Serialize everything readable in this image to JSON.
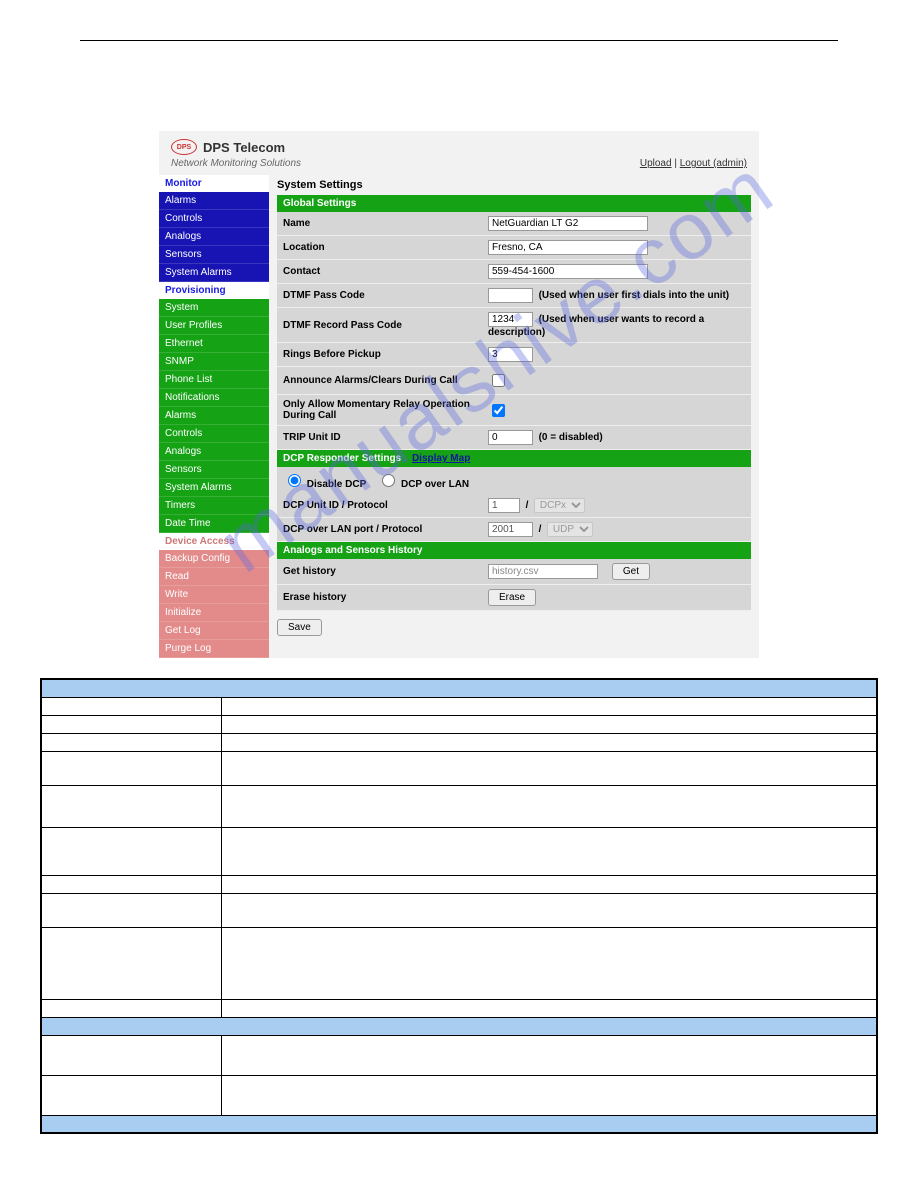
{
  "brand": {
    "name": "DPS Telecom",
    "tagline": "Network Monitoring Solutions",
    "logo_initials": "DPS"
  },
  "header_links": {
    "upload": "Upload",
    "logout": "Logout (admin)"
  },
  "sidebar": {
    "monitor": "Monitor",
    "monitor_items": [
      "Alarms",
      "Controls",
      "Analogs",
      "Sensors",
      "System Alarms"
    ],
    "provisioning": "Provisioning",
    "prov_items": [
      "System",
      "User Profiles",
      "Ethernet",
      "SNMP",
      "Phone List",
      "Notifications",
      "Alarms",
      "Controls",
      "Analogs",
      "Sensors",
      "System Alarms",
      "Timers",
      "Date Time"
    ],
    "device_access": "Device Access",
    "da_items": [
      "Backup Config",
      "Read",
      "Write",
      "Initialize",
      "Get Log",
      "Purge Log"
    ]
  },
  "main": {
    "title": "System Settings",
    "section_global": "Global Settings",
    "section_dcp": "DCP Responder Settings",
    "dcp_link": "Display Map",
    "section_hist": "Analogs and Sensors History",
    "rows": {
      "name_label": "Name",
      "name_value": "NetGuardian LT G2",
      "location_label": "Location",
      "location_value": "Fresno, CA",
      "contact_label": "Contact",
      "contact_value": "559-454-1600",
      "dtmf_pass_label": "DTMF Pass Code",
      "dtmf_pass_value": "",
      "dtmf_pass_hint": "(Used when user first dials into the unit)",
      "dtmf_rec_label": "DTMF Record Pass Code",
      "dtmf_rec_value": "1234",
      "dtmf_rec_hint": "(Used when user wants to record a description)",
      "rings_label": "Rings Before Pickup",
      "rings_value": "3",
      "announce_label": "Announce Alarms/Clears During Call",
      "relay_label": "Only Allow Momentary Relay Operation During Call",
      "trip_label": "TRIP Unit ID",
      "trip_value": "0",
      "trip_hint": "(0 = disabled)",
      "dcp_disable": "Disable DCP",
      "dcp_over_lan": "DCP over LAN",
      "dcp_unit_label": "DCP Unit ID / Protocol",
      "dcp_unit_value": "1",
      "dcp_proto_value": "DCPx",
      "dcp_port_label": "DCP over LAN port / Protocol",
      "dcp_port_value": "2001",
      "dcp_port_proto": "UDP",
      "get_hist_label": "Get history",
      "get_hist_value": "history.csv",
      "get_btn": "Get",
      "erase_label": "Erase history",
      "erase_btn": "Erase",
      "save_btn": "Save",
      "slash": "/"
    }
  },
  "watermark": "manualshive.com"
}
